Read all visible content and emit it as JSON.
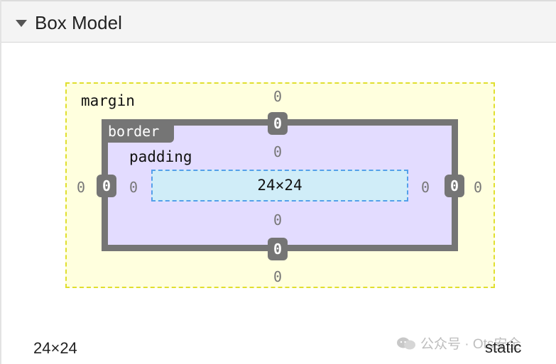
{
  "header": {
    "title": "Box Model"
  },
  "box_model": {
    "margin": {
      "label": "margin",
      "top": "0",
      "right": "0",
      "bottom": "0",
      "left": "0"
    },
    "border": {
      "label": "border",
      "top": "0",
      "right": "0",
      "bottom": "0",
      "left": "0"
    },
    "padding": {
      "label": "padding",
      "top": "0",
      "right": "0",
      "bottom": "0",
      "left": "0"
    },
    "content": {
      "size": "24×24"
    }
  },
  "footer": {
    "size": "24×24",
    "position": "static"
  },
  "watermark": {
    "text": "公众号 · Ots安全"
  },
  "colors": {
    "margin_bg": "#ffffde",
    "margin_border": "#e0df2e",
    "border": "#757575",
    "padding_bg": "#e3dcff",
    "content_bg": "#d0edf8",
    "content_border": "#54a0ea"
  }
}
